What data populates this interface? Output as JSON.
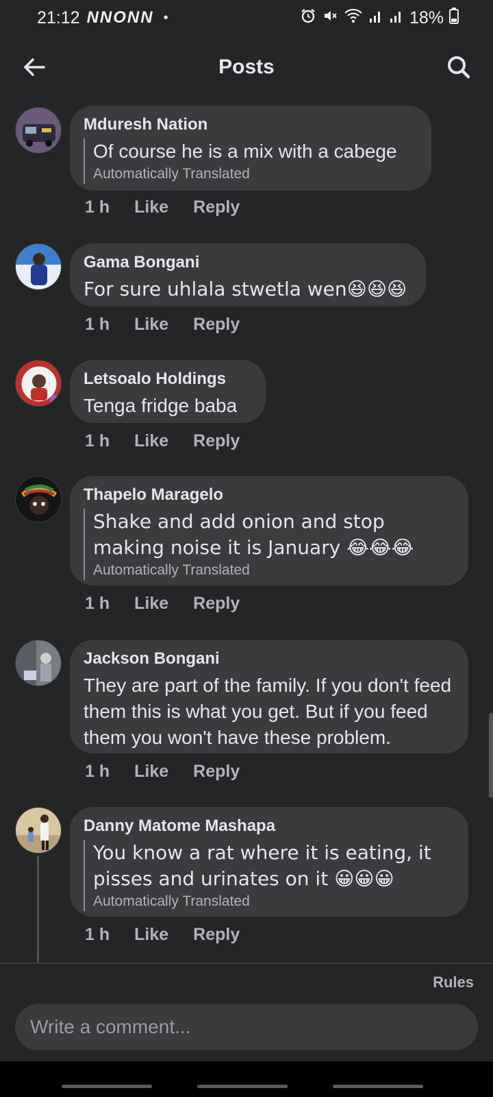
{
  "status_bar": {
    "time": "21:12",
    "notifications": "NNONN",
    "dot": "•",
    "battery": "18%",
    "icons": [
      "alarm-icon",
      "mute-icon",
      "wifi-icon",
      "signal-icon",
      "signal-icon",
      "battery-icon"
    ]
  },
  "header": {
    "title": "Posts",
    "back_icon": "back-arrow-icon",
    "search_icon": "search-icon"
  },
  "comments": [
    {
      "name": "Mduresh Nation",
      "text": "Of course he is a mix with a cabege",
      "translated_label": "Automatically Translated",
      "time": "1 h",
      "like": "Like",
      "reply": "Reply"
    },
    {
      "name": "Gama Bongani",
      "text": "For sure uhlala stwetla wen😆😆😆",
      "time": "1 h",
      "like": "Like",
      "reply": "Reply"
    },
    {
      "name": "Letsoalo Holdings",
      "text": "Tenga fridge baba",
      "time": "1 h",
      "like": "Like",
      "reply": "Reply"
    },
    {
      "name": "Thapelo Maragelo",
      "text": "Shake and add onion and stop making noise it is January 😂😂😂",
      "translated_label": "Automatically Translated",
      "time": "1 h",
      "like": "Like",
      "reply": "Reply"
    },
    {
      "name": "Jackson Bongani",
      "text": "They are part of the family. If you don't feed them this is what you get. But if you feed them you won't have these problem.",
      "time": "1 h",
      "like": "Like",
      "reply": "Reply"
    },
    {
      "name": "Danny Matome Mashapa",
      "text": "You know a rat where it is eating, it pisses and urinates on it 😀😀😀",
      "translated_label": "Automatically Translated",
      "time": "1 h",
      "like": "Like",
      "reply": "Reply"
    }
  ],
  "footer": {
    "rules": "Rules",
    "comment_placeholder": "Write a comment..."
  },
  "colors": {
    "background": "#242526",
    "bubble": "#3a3b3c",
    "primary_text": "#e4e6eb",
    "secondary_text": "#b0b3b8"
  }
}
